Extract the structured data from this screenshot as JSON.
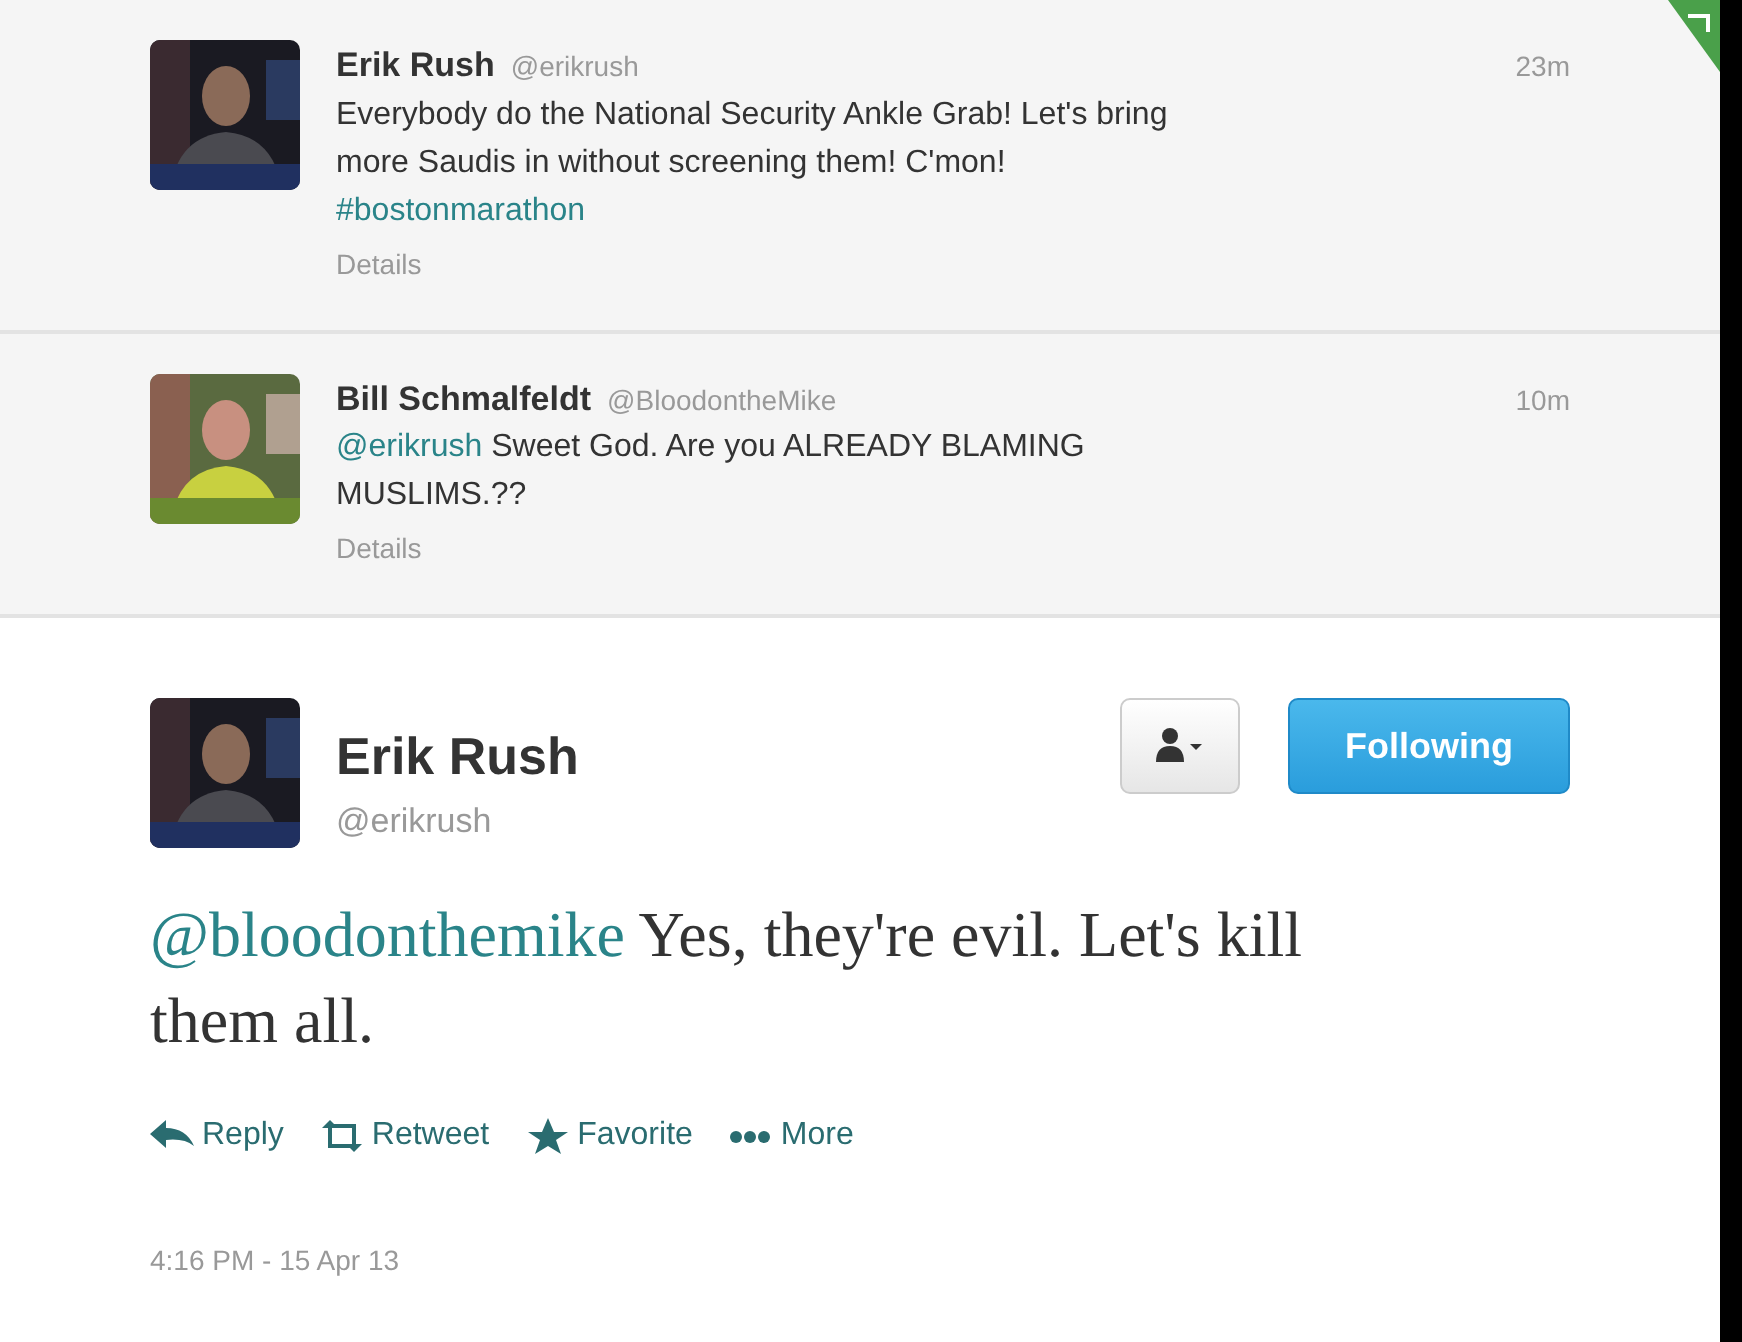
{
  "replies": [
    {
      "name": "Erik Rush",
      "handle": "@erikrush",
      "time": "23m",
      "text": "Everybody do the National Security Ankle Grab! Let's bring more Saudis in without screening them! C'mon!",
      "hashtag": "#bostonmarathon",
      "details": "Details"
    },
    {
      "name": "Bill Schmalfeldt",
      "handle": "@BloodontheMike",
      "time": "10m",
      "mention": "@erikrush",
      "text": "Sweet God. Are you ALREADY BLAMING MUSLIMS.??",
      "details": "Details"
    }
  ],
  "tweet": {
    "name": "Erik Rush",
    "handle": "@erikrush",
    "follow_button": {
      "label": "Following",
      "selected": true
    },
    "mention": "@bloodonthemike",
    "text": "Yes, they're evil. Let's kill them all.",
    "actions": [
      {
        "kind": "reply",
        "label": "Reply"
      },
      {
        "kind": "retweet",
        "label": "Retweet"
      },
      {
        "kind": "favorite",
        "label": "Favorite"
      },
      {
        "kind": "more",
        "label": "More"
      }
    ],
    "timestamp": "4:16 PM - 15 Apr 13"
  }
}
